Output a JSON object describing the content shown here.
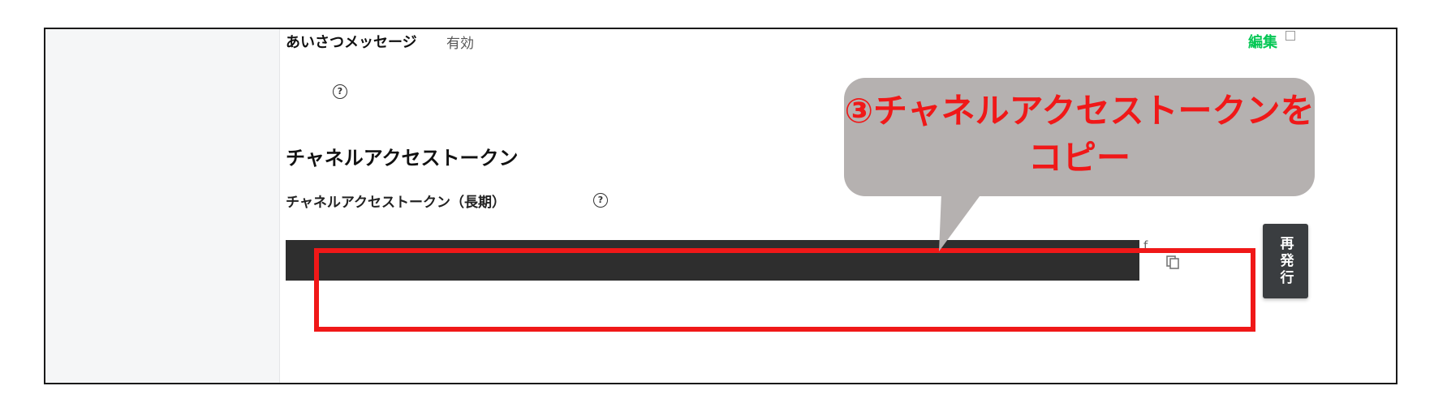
{
  "settings": {
    "greeting": {
      "label": "あいさつメッセージ",
      "status": "有効",
      "edit": "編集"
    },
    "token_section": {
      "title": "チャネルアクセストークン",
      "field_label": "チャネルアクセストークン（長期）"
    },
    "reissue_button": "再発行",
    "token_visible_fragment": "f"
  },
  "annotation": {
    "text": "③チャネルアクセストークンをコピー"
  },
  "colors": {
    "annotation_red": "#f01818",
    "link_green": "#06c755",
    "callout_bg": "#b5b1b0"
  },
  "icons": [
    "help-icon",
    "external-link-icon",
    "copy-icon"
  ]
}
